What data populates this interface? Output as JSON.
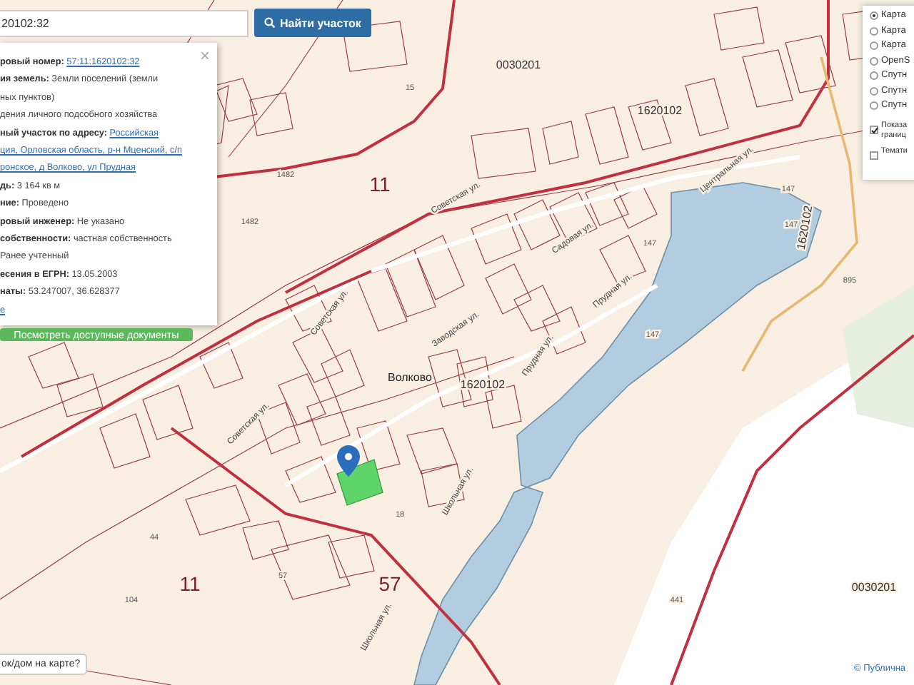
{
  "search": {
    "value": "20102:32",
    "button": "Найти участок"
  },
  "info": {
    "close": "×",
    "rows": [
      {
        "label": "ровый номер: ",
        "value": "57:11:1620102:32",
        "kind": "link"
      },
      {
        "label": "ия земель: ",
        "value": "Земли поселений (земли",
        "kind": "text"
      },
      {
        "value": "ных пунктов)",
        "kind": "text"
      },
      {
        "value": "дения личного подсобного хозяйства",
        "kind": "text"
      },
      {
        "label": "ный участок по адресу: ",
        "value": "Российская",
        "kind": "link"
      },
      {
        "value": "ция, Орловская область, р-н Мценский, с/п",
        "kind": "link"
      },
      {
        "value": "ронское, д Волково, ул Прудная",
        "kind": "link"
      },
      {
        "label": "дь: ",
        "value": "3 164 кв м",
        "kind": "text"
      },
      {
        "label": "ние: ",
        "value": "Проведено",
        "kind": "text"
      },
      {
        "label": "ровый инженер: ",
        "value": "Не указано",
        "kind": "text"
      },
      {
        "label": "собственности: ",
        "value": "частная собственность",
        "kind": "text"
      },
      {
        "value": "Ранее учтенный",
        "kind": "text"
      },
      {
        "label": "есения в ЕГРН: ",
        "value": "13.05.2003",
        "kind": "text"
      },
      {
        "label": "наты: ",
        "value": "53.247007, 36.628377",
        "kind": "text"
      },
      {
        "value": "е",
        "kind": "link"
      }
    ],
    "button": "Посмотреть доступные документы"
  },
  "layers": [
    {
      "label": "Карта",
      "kind": "radio",
      "selected": true
    },
    {
      "label": "Карта",
      "kind": "radio",
      "selected": false
    },
    {
      "label": "Карта",
      "kind": "radio",
      "selected": false
    },
    {
      "label": "OpenS",
      "kind": "radio",
      "selected": false
    },
    {
      "label": "Спутн",
      "kind": "radio",
      "selected": false
    },
    {
      "label": "Спутн",
      "kind": "radio",
      "selected": false
    },
    {
      "label": "Спутн",
      "kind": "radio",
      "selected": false
    },
    {
      "label": "Показа границ",
      "kind": "checkbox",
      "checked": true
    },
    {
      "label": "Темати",
      "kind": "checkbox",
      "checked": false
    }
  ],
  "map_labels": [
    {
      "text": "0030201",
      "kind": "quarter"
    },
    {
      "text": "15",
      "kind": "parcel"
    },
    {
      "text": "1620102",
      "kind": "quarter"
    },
    {
      "text": "Центральная ул.",
      "kind": "street"
    },
    {
      "text": "1482",
      "kind": "parcel"
    },
    {
      "text": "11",
      "kind": "zone"
    },
    {
      "text": "147",
      "kind": "parcel"
    },
    {
      "text": "Советская ул.",
      "kind": "street"
    },
    {
      "text": "1482",
      "kind": "parcel"
    },
    {
      "text": "147",
      "kind": "parcel"
    },
    {
      "text": "1620102",
      "kind": "quarter"
    },
    {
      "text": "Садовая ул.",
      "kind": "street"
    },
    {
      "text": "147",
      "kind": "parcel"
    },
    {
      "text": "895",
      "kind": "parcel"
    },
    {
      "text": "Прудная ул.",
      "kind": "street"
    },
    {
      "text": "Советская ул.",
      "kind": "street"
    },
    {
      "text": "Заводская ул.",
      "kind": "street"
    },
    {
      "text": "147",
      "kind": "parcel"
    },
    {
      "text": "Прудная ул.",
      "kind": "street"
    },
    {
      "text": "Волково",
      "kind": "village"
    },
    {
      "text": "1620102",
      "kind": "quarter"
    },
    {
      "text": "Советская ул.",
      "kind": "street"
    },
    {
      "text": "Школьная ул.",
      "kind": "street"
    },
    {
      "text": "18",
      "kind": "parcel"
    },
    {
      "text": "44",
      "kind": "parcel"
    },
    {
      "text": "57",
      "kind": "parcel"
    },
    {
      "text": "11",
      "kind": "zone"
    },
    {
      "text": "57",
      "kind": "zone"
    },
    {
      "text": "0030201",
      "kind": "quarter"
    },
    {
      "text": "104",
      "kind": "parcel"
    },
    {
      "text": "441",
      "kind": "parcel"
    },
    {
      "text": "Школьная ул.",
      "kind": "street"
    }
  ],
  "tooltip": "ок/дом на карте?",
  "attribution": "© Публична"
}
